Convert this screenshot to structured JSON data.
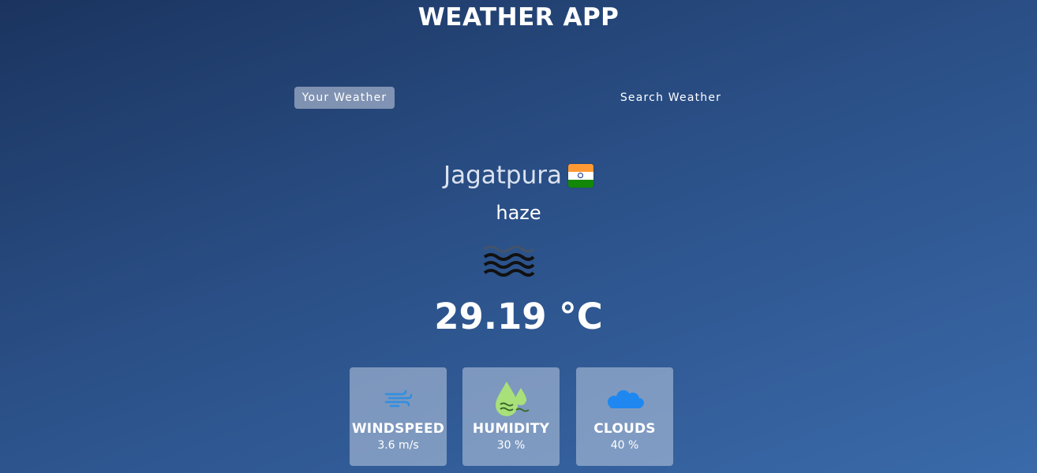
{
  "app": {
    "title": "WEATHER APP"
  },
  "tabs": [
    {
      "label": "Your Weather",
      "active": true
    },
    {
      "label": "Search Weather",
      "active": false
    }
  ],
  "location": {
    "city": "Jagatpura",
    "flag_icon": "india-flag-icon"
  },
  "weather": {
    "condition": "haze",
    "icon": "haze-icon",
    "temperature": "29.19 °C"
  },
  "stats": [
    {
      "label": "WINDSPEED",
      "value": "3.6 m/s",
      "icon": "wind-icon",
      "color": "#2f8fe0"
    },
    {
      "label": "HUMIDITY",
      "value": "30 %",
      "icon": "humidity-drop-icon",
      "color": "#a9e07a"
    },
    {
      "label": "CLOUDS",
      "value": "40 %",
      "icon": "cloud-icon",
      "color": "#1e88f0"
    }
  ],
  "colors": {
    "background_start": "#1b345f",
    "background_end": "#3a6aaa",
    "active_tab": "#dbe2ef",
    "card_bg": "#becce2"
  }
}
